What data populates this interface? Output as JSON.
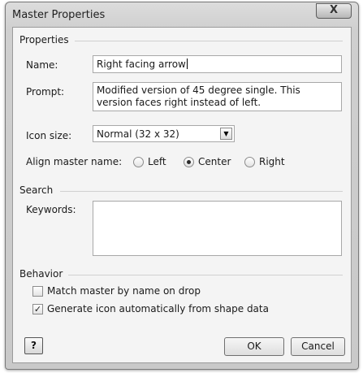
{
  "window": {
    "title": "Master Properties",
    "close_glyph": "X"
  },
  "properties": {
    "group_label": "Properties",
    "name_label": "Name:",
    "name_value": "Right facing arrow",
    "prompt_label": "Prompt:",
    "prompt_value": "Modified version of 45 degree single. This version faces right instead of left.",
    "icon_size_label": "Icon size:",
    "icon_size_value": "Normal (32 x 32)",
    "icon_size_arrow_glyph": "▼",
    "align_label": "Align master name:",
    "align_options": [
      "Left",
      "Center",
      "Right"
    ],
    "align_selected": "Center"
  },
  "search": {
    "group_label": "Search",
    "keywords_label": "Keywords:",
    "keywords_value": ""
  },
  "behavior": {
    "group_label": "Behavior",
    "match_label": "Match master by name on drop",
    "match_checked": false,
    "generate_label": "Generate icon automatically from shape data",
    "generate_checked": true,
    "check_glyph": "✓"
  },
  "buttons": {
    "help_glyph": "?",
    "ok": "OK",
    "cancel": "Cancel"
  }
}
